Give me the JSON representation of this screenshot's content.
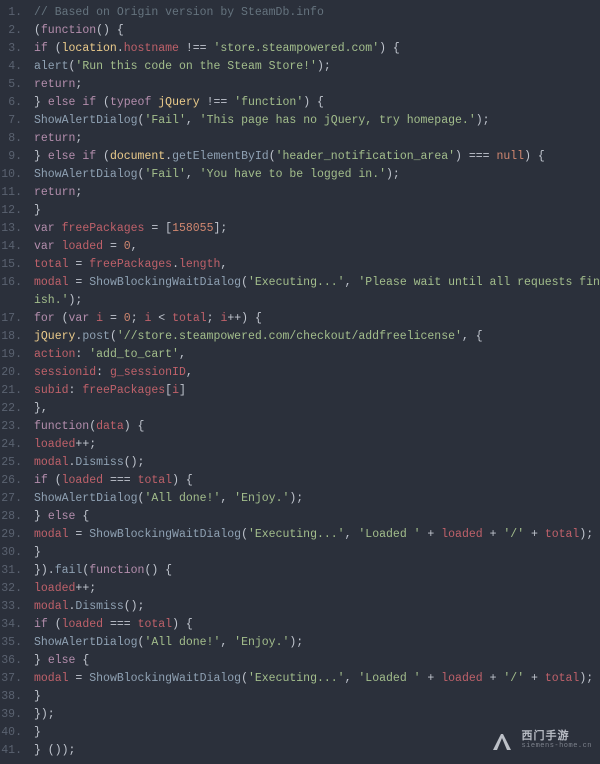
{
  "watermark": {
    "main": "西门手游",
    "sub": "siemens-home.cn"
  },
  "lines": [
    {
      "n": "1.",
      "tokens": [
        [
          "// Based on Origin version by SteamDb.info",
          "c-comment"
        ]
      ]
    },
    {
      "n": "2.",
      "tokens": [
        [
          "(",
          "c-punc"
        ],
        [
          "function",
          "c-kw"
        ],
        [
          "() {",
          "c-punc"
        ]
      ]
    },
    {
      "n": "3.",
      "tokens": [
        [
          "if",
          "c-kw"
        ],
        [
          " (",
          "c-punc"
        ],
        [
          "location",
          "c-builtin"
        ],
        [
          ".",
          "c-punc"
        ],
        [
          "hostname",
          "c-var"
        ],
        [
          " !== ",
          "c-op"
        ],
        [
          "'store.steampowered.com'",
          "c-str"
        ],
        [
          ") {",
          "c-punc"
        ]
      ]
    },
    {
      "n": "4.",
      "tokens": [
        [
          "alert",
          "c-fn"
        ],
        [
          "(",
          "c-punc"
        ],
        [
          "'Run this code on the Steam Store!'",
          "c-str"
        ],
        [
          ");",
          "c-punc"
        ]
      ]
    },
    {
      "n": "5.",
      "tokens": [
        [
          "return",
          "c-kw"
        ],
        [
          ";",
          "c-punc"
        ]
      ]
    },
    {
      "n": "6.",
      "tokens": [
        [
          "} ",
          "c-punc"
        ],
        [
          "else if",
          "c-kw"
        ],
        [
          " (",
          "c-punc"
        ],
        [
          "typeof",
          "c-kw"
        ],
        [
          " ",
          "c-punc"
        ],
        [
          "jQuery",
          "c-builtin"
        ],
        [
          " !== ",
          "c-op"
        ],
        [
          "'function'",
          "c-str"
        ],
        [
          ") {",
          "c-punc"
        ]
      ]
    },
    {
      "n": "7.",
      "tokens": [
        [
          "ShowAlertDialog",
          "c-fn"
        ],
        [
          "(",
          "c-punc"
        ],
        [
          "'Fail'",
          "c-str"
        ],
        [
          ", ",
          "c-punc"
        ],
        [
          "'This page has no jQuery, try homepage.'",
          "c-str"
        ],
        [
          ");",
          "c-punc"
        ]
      ]
    },
    {
      "n": "8.",
      "tokens": [
        [
          "return",
          "c-kw"
        ],
        [
          ";",
          "c-punc"
        ]
      ]
    },
    {
      "n": "9.",
      "tokens": [
        [
          "} ",
          "c-punc"
        ],
        [
          "else if",
          "c-kw"
        ],
        [
          " (",
          "c-punc"
        ],
        [
          "document",
          "c-builtin"
        ],
        [
          ".",
          "c-punc"
        ],
        [
          "getElementById",
          "c-fn"
        ],
        [
          "(",
          "c-punc"
        ],
        [
          "'header_notification_area'",
          "c-str"
        ],
        [
          ") === ",
          "c-op"
        ],
        [
          "null",
          "c-const"
        ],
        [
          ") {",
          "c-punc"
        ]
      ]
    },
    {
      "n": "10.",
      "tokens": [
        [
          "ShowAlertDialog",
          "c-fn"
        ],
        [
          "(",
          "c-punc"
        ],
        [
          "'Fail'",
          "c-str"
        ],
        [
          ", ",
          "c-punc"
        ],
        [
          "'You have to be logged in.'",
          "c-str"
        ],
        [
          ");",
          "c-punc"
        ]
      ]
    },
    {
      "n": "11.",
      "tokens": [
        [
          "return",
          "c-kw"
        ],
        [
          ";",
          "c-punc"
        ]
      ]
    },
    {
      "n": "12.",
      "tokens": [
        [
          "}",
          "c-punc"
        ]
      ]
    },
    {
      "n": "13.",
      "tokens": [
        [
          "var",
          "c-kw"
        ],
        [
          " ",
          "c-punc"
        ],
        [
          "freePackages",
          "c-var"
        ],
        [
          " = [",
          "c-punc"
        ],
        [
          "158055",
          "c-num"
        ],
        [
          "];",
          "c-punc"
        ]
      ]
    },
    {
      "n": "14.",
      "tokens": [
        [
          "var",
          "c-kw"
        ],
        [
          " ",
          "c-punc"
        ],
        [
          "loaded",
          "c-var"
        ],
        [
          " = ",
          "c-punc"
        ],
        [
          "0",
          "c-num"
        ],
        [
          ",",
          "c-punc"
        ]
      ]
    },
    {
      "n": "15.",
      "tokens": [
        [
          "total",
          "c-var"
        ],
        [
          " = ",
          "c-punc"
        ],
        [
          "freePackages",
          "c-var"
        ],
        [
          ".",
          "c-punc"
        ],
        [
          "length",
          "c-var"
        ],
        [
          ",",
          "c-punc"
        ]
      ]
    },
    {
      "n": "16.",
      "tokens": [
        [
          "modal",
          "c-var"
        ],
        [
          " = ",
          "c-punc"
        ],
        [
          "ShowBlockingWaitDialog",
          "c-fn"
        ],
        [
          "(",
          "c-punc"
        ],
        [
          "'Executing...'",
          "c-str"
        ],
        [
          ", ",
          "c-punc"
        ],
        [
          "'Please wait until all requests finish.'",
          "c-str"
        ],
        [
          ");",
          "c-punc"
        ]
      ]
    },
    {
      "n": "17.",
      "tokens": [
        [
          "for",
          "c-kw"
        ],
        [
          " (",
          "c-punc"
        ],
        [
          "var",
          "c-kw"
        ],
        [
          " ",
          "c-punc"
        ],
        [
          "i",
          "c-var"
        ],
        [
          " = ",
          "c-punc"
        ],
        [
          "0",
          "c-num"
        ],
        [
          "; ",
          "c-punc"
        ],
        [
          "i",
          "c-var"
        ],
        [
          " < ",
          "c-op"
        ],
        [
          "total",
          "c-var"
        ],
        [
          "; ",
          "c-punc"
        ],
        [
          "i",
          "c-var"
        ],
        [
          "++) {",
          "c-punc"
        ]
      ]
    },
    {
      "n": "18.",
      "tokens": [
        [
          "jQuery",
          "c-builtin"
        ],
        [
          ".",
          "c-punc"
        ],
        [
          "post",
          "c-fn"
        ],
        [
          "(",
          "c-punc"
        ],
        [
          "'//store.steampowered.com/checkout/addfreelicense'",
          "c-str"
        ],
        [
          ", {",
          "c-punc"
        ]
      ]
    },
    {
      "n": "19.",
      "tokens": [
        [
          "action",
          "c-var"
        ],
        [
          ": ",
          "c-punc"
        ],
        [
          "'add_to_cart'",
          "c-str"
        ],
        [
          ",",
          "c-punc"
        ]
      ]
    },
    {
      "n": "20.",
      "tokens": [
        [
          "sessionid",
          "c-var"
        ],
        [
          ": ",
          "c-punc"
        ],
        [
          "g_sessionID",
          "c-var"
        ],
        [
          ",",
          "c-punc"
        ]
      ]
    },
    {
      "n": "21.",
      "tokens": [
        [
          "subid",
          "c-var"
        ],
        [
          ": ",
          "c-punc"
        ],
        [
          "freePackages",
          "c-var"
        ],
        [
          "[",
          "c-punc"
        ],
        [
          "i",
          "c-var"
        ],
        [
          "]",
          "c-punc"
        ]
      ]
    },
    {
      "n": "22.",
      "tokens": [
        [
          "},",
          "c-punc"
        ]
      ]
    },
    {
      "n": "23.",
      "tokens": [
        [
          "function",
          "c-kw"
        ],
        [
          "(",
          "c-punc"
        ],
        [
          "data",
          "c-var"
        ],
        [
          ") {",
          "c-punc"
        ]
      ]
    },
    {
      "n": "24.",
      "tokens": [
        [
          "loaded",
          "c-var"
        ],
        [
          "++;",
          "c-punc"
        ]
      ]
    },
    {
      "n": "25.",
      "tokens": [
        [
          "modal",
          "c-var"
        ],
        [
          ".",
          "c-punc"
        ],
        [
          "Dismiss",
          "c-fn"
        ],
        [
          "();",
          "c-punc"
        ]
      ]
    },
    {
      "n": "26.",
      "tokens": [
        [
          "if",
          "c-kw"
        ],
        [
          " (",
          "c-punc"
        ],
        [
          "loaded",
          "c-var"
        ],
        [
          " === ",
          "c-op"
        ],
        [
          "total",
          "c-var"
        ],
        [
          ") {",
          "c-punc"
        ]
      ]
    },
    {
      "n": "27.",
      "tokens": [
        [
          "ShowAlertDialog",
          "c-fn"
        ],
        [
          "(",
          "c-punc"
        ],
        [
          "'All done!'",
          "c-str"
        ],
        [
          ", ",
          "c-punc"
        ],
        [
          "'Enjoy.'",
          "c-str"
        ],
        [
          ");",
          "c-punc"
        ]
      ]
    },
    {
      "n": "28.",
      "tokens": [
        [
          "} ",
          "c-punc"
        ],
        [
          "else",
          "c-kw"
        ],
        [
          " {",
          "c-punc"
        ]
      ]
    },
    {
      "n": "29.",
      "tokens": [
        [
          "modal",
          "c-var"
        ],
        [
          " = ",
          "c-punc"
        ],
        [
          "ShowBlockingWaitDialog",
          "c-fn"
        ],
        [
          "(",
          "c-punc"
        ],
        [
          "'Executing...'",
          "c-str"
        ],
        [
          ", ",
          "c-punc"
        ],
        [
          "'Loaded '",
          "c-str"
        ],
        [
          " + ",
          "c-op"
        ],
        [
          "loaded",
          "c-var"
        ],
        [
          " + ",
          "c-op"
        ],
        [
          "'/'",
          "c-str"
        ],
        [
          " + ",
          "c-op"
        ],
        [
          "total",
          "c-var"
        ],
        [
          ");",
          "c-punc"
        ]
      ]
    },
    {
      "n": "30.",
      "tokens": [
        [
          "}",
          "c-punc"
        ]
      ]
    },
    {
      "n": "31.",
      "tokens": [
        [
          "}).",
          "c-punc"
        ],
        [
          "fail",
          "c-fn"
        ],
        [
          "(",
          "c-punc"
        ],
        [
          "function",
          "c-kw"
        ],
        [
          "() {",
          "c-punc"
        ]
      ]
    },
    {
      "n": "32.",
      "tokens": [
        [
          "loaded",
          "c-var"
        ],
        [
          "++;",
          "c-punc"
        ]
      ]
    },
    {
      "n": "33.",
      "tokens": [
        [
          "modal",
          "c-var"
        ],
        [
          ".",
          "c-punc"
        ],
        [
          "Dismiss",
          "c-fn"
        ],
        [
          "();",
          "c-punc"
        ]
      ]
    },
    {
      "n": "34.",
      "tokens": [
        [
          "if",
          "c-kw"
        ],
        [
          " (",
          "c-punc"
        ],
        [
          "loaded",
          "c-var"
        ],
        [
          " === ",
          "c-op"
        ],
        [
          "total",
          "c-var"
        ],
        [
          ") {",
          "c-punc"
        ]
      ]
    },
    {
      "n": "35.",
      "tokens": [
        [
          "ShowAlertDialog",
          "c-fn"
        ],
        [
          "(",
          "c-punc"
        ],
        [
          "'All done!'",
          "c-str"
        ],
        [
          ", ",
          "c-punc"
        ],
        [
          "'Enjoy.'",
          "c-str"
        ],
        [
          ");",
          "c-punc"
        ]
      ]
    },
    {
      "n": "36.",
      "tokens": [
        [
          "} ",
          "c-punc"
        ],
        [
          "else",
          "c-kw"
        ],
        [
          " {",
          "c-punc"
        ]
      ]
    },
    {
      "n": "37.",
      "tokens": [
        [
          "modal",
          "c-var"
        ],
        [
          " = ",
          "c-punc"
        ],
        [
          "ShowBlockingWaitDialog",
          "c-fn"
        ],
        [
          "(",
          "c-punc"
        ],
        [
          "'Executing...'",
          "c-str"
        ],
        [
          ", ",
          "c-punc"
        ],
        [
          "'Loaded '",
          "c-str"
        ],
        [
          " + ",
          "c-op"
        ],
        [
          "loaded",
          "c-var"
        ],
        [
          " + ",
          "c-op"
        ],
        [
          "'/'",
          "c-str"
        ],
        [
          " + ",
          "c-op"
        ],
        [
          "total",
          "c-var"
        ],
        [
          ");",
          "c-punc"
        ]
      ]
    },
    {
      "n": "38.",
      "tokens": [
        [
          "}",
          "c-punc"
        ]
      ]
    },
    {
      "n": "39.",
      "tokens": [
        [
          "});",
          "c-punc"
        ]
      ]
    },
    {
      "n": "40.",
      "tokens": [
        [
          "}",
          "c-punc"
        ]
      ]
    },
    {
      "n": "41.",
      "tokens": [
        [
          "} ());",
          "c-punc"
        ]
      ]
    }
  ]
}
